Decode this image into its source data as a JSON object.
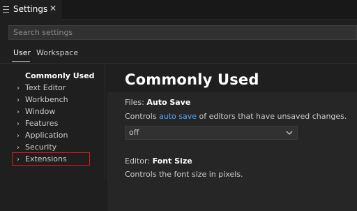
{
  "tab": {
    "title": "Settings",
    "close": "✕"
  },
  "search": {
    "placeholder": "Search settings"
  },
  "scopes": {
    "user": "User",
    "workspace": "Workspace"
  },
  "toc": {
    "common": "Commonly Used",
    "items": [
      "Text Editor",
      "Workbench",
      "Window",
      "Features",
      "Application",
      "Security",
      "Extensions"
    ],
    "chevron": "›"
  },
  "content": {
    "heading": "Commonly Used",
    "auto_save": {
      "category": "Files:",
      "name": "Auto Save",
      "desc_pre": "Controls ",
      "desc_link": "auto save",
      "desc_post": " of editors that have unsaved changes.",
      "value": "off"
    },
    "font_size": {
      "category": "Editor:",
      "name": "Font Size",
      "desc": "Controls the font size in pixels."
    }
  },
  "colors": {
    "link": "#4daafc",
    "highlight": "#e81123",
    "background": "#1f1f1f"
  }
}
